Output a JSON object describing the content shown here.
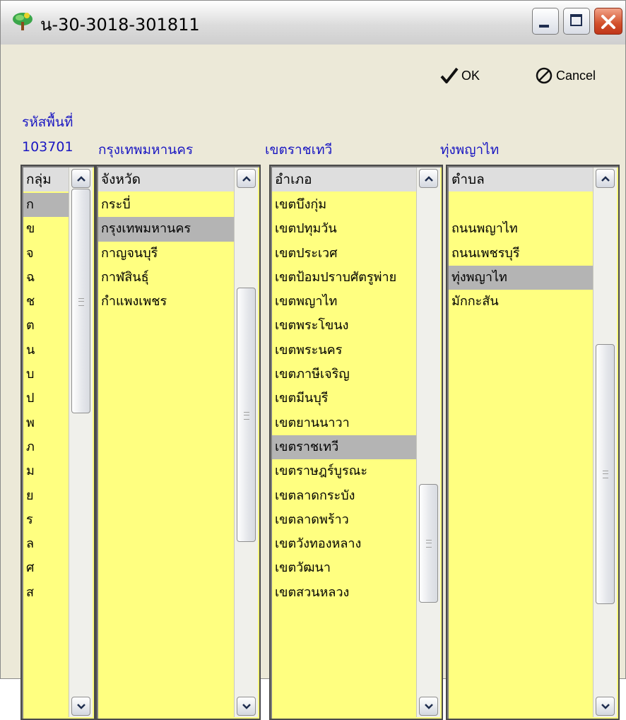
{
  "window": {
    "title": "น-30-3018-301811"
  },
  "buttons": {
    "ok_label": "OK",
    "cancel_label": "Cancel"
  },
  "location": {
    "area_code_label": "รหัสพื้นที่",
    "area_code_value": "103701",
    "selected_province": "กรุงเทพมหานคร",
    "selected_district": "เขตราชเทวี",
    "selected_subdistrict": "ทุ่งพญาไท"
  },
  "lists": {
    "group": {
      "header": "กลุ่ม",
      "selected_index": 0,
      "items": [
        "ก",
        "ข",
        "จ",
        "ฉ",
        "ช",
        "ต",
        "น",
        "บ",
        "ป",
        "พ",
        "ภ",
        "ม",
        "ย",
        "ร",
        "ล",
        "ศ",
        "ส"
      ]
    },
    "province": {
      "header": "จังหวัด",
      "selected_index": 1,
      "items": [
        "กระบี่",
        "กรุงเทพมหานคร",
        "กาญจนบุรี",
        "กาฬสินธุ์",
        "กำแพงเพชร"
      ]
    },
    "district": {
      "header": "อำเภอ",
      "selected_index": 10,
      "items": [
        "เขตบึงกุ่ม",
        "เขตปทุมวัน",
        "เขตประเวศ",
        "เขตป้อมปราบศัตรูพ่าย",
        "เขตพญาไท",
        "เขตพระโขนง",
        "เขตพระนคร",
        "เขตภาษีเจริญ",
        "เขตมีนบุรี",
        "เขตยานนาวา",
        "เขตราชเทวี",
        "เขตราษฎร์บูรณะ",
        "เขตลาดกระบัง",
        "เขตลาดพร้าว",
        "เขตวังทองหลาง",
        "เขตวัฒนา",
        "เขตสวนหลวง"
      ]
    },
    "subdistrict": {
      "header": "ตำบล",
      "selected_index": 3,
      "items": [
        "",
        "ถนนพญาไท",
        "ถนนเพชรบุรี",
        "ทุ่งพญาไท",
        "มักกะสัน"
      ]
    }
  },
  "colors": {
    "list_background": "#ffff80",
    "selection": "#b4b4b4",
    "label_text": "#1a17c2"
  }
}
